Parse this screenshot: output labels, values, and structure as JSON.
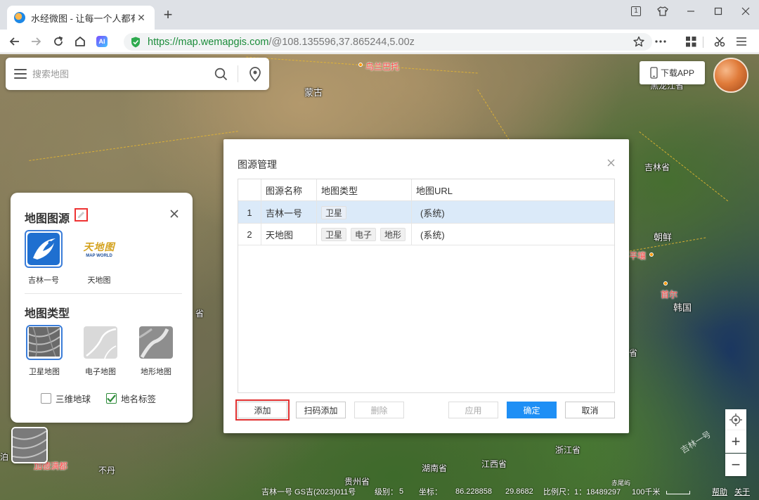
{
  "browser": {
    "tab_title": "水经微图 - 让每一个人都有自",
    "tab_close": "✕",
    "new_tab": "+",
    "tab_count": "1",
    "url_host": "https://map.wemapgis.com",
    "url_path": "/@108.135596,37.865244,5.00z",
    "icons": [
      "back-icon",
      "forward-icon",
      "reload-icon",
      "home-icon",
      "ai-icon",
      "shield-icon",
      "star-icon",
      "more-icon",
      "apps-icon",
      "cut-icon",
      "menu-icon"
    ],
    "ai_label": "AI"
  },
  "search": {
    "placeholder": "搜索地图"
  },
  "download_app": {
    "label": "下载APP"
  },
  "map_labels": {
    "ulaanbaatar": "乌兰巴托",
    "mongolia": "蒙古",
    "heilongjiang": "黑龙江省",
    "jilin": "吉林省",
    "korea_north": "朝鲜",
    "pyongyang": "平壤",
    "seoul": "首尔",
    "korea_south": "韩国",
    "sheng_left": "省",
    "sheng_right": "省",
    "zhejiang": "浙江省",
    "hunan": "湖南省",
    "jiangxi": "江西省",
    "guizhou": "贵州省",
    "bhutan": "不丹",
    "kathmandu": "加德满都",
    "bo": "泊"
  },
  "source_panel": {
    "title": "地图图源",
    "sources": [
      {
        "label": "吉林一号"
      },
      {
        "label": "天地图",
        "logo_text": "天地图",
        "logo_sub": "MAP WORLD"
      }
    ],
    "type_title": "地图类型",
    "types": [
      {
        "label": "卫星地图",
        "selected": true
      },
      {
        "label": "电子地图",
        "selected": false
      },
      {
        "label": "地形地图",
        "selected": false
      }
    ],
    "checkboxes": [
      {
        "label": "三维地球",
        "checked": false
      },
      {
        "label": "地名标签",
        "checked": true
      }
    ]
  },
  "dialog": {
    "title": "图源管理",
    "columns": [
      "",
      "图源名称",
      "地图类型",
      "地图URL"
    ],
    "rows": [
      {
        "index": "1",
        "name": "吉林一号",
        "types": [
          "卫星"
        ],
        "url": "(系统)",
        "selected": true
      },
      {
        "index": "2",
        "name": "天地图",
        "types": [
          "卫星",
          "电子",
          "地形"
        ],
        "url": "(系统)",
        "selected": false
      }
    ],
    "buttons": {
      "add": "添加",
      "scan_add": "扫码添加",
      "delete": "删除",
      "apply": "应用",
      "ok": "确定",
      "cancel": "取消"
    }
  },
  "zoom_controls": {
    "plus": "+",
    "minus": "−"
  },
  "status_bar": {
    "attribution": "吉林一号 GS吉(2023)011号",
    "level_label": "级别：",
    "level_value": "5",
    "coord_label": "坐标：",
    "lon": "86.228858",
    "lat": "29.8682",
    "scale_label": "比例尺：1：18489297",
    "place": "赤尾屿",
    "scale_text": "100千米",
    "help": "帮助",
    "about": "关于"
  },
  "watermark": "吉林一号",
  "colors": {
    "accent": "#1e8ff5",
    "highlight_red": "#e03030",
    "selected_row": "#dbeaf9",
    "url_green": "#1b8c3a"
  }
}
